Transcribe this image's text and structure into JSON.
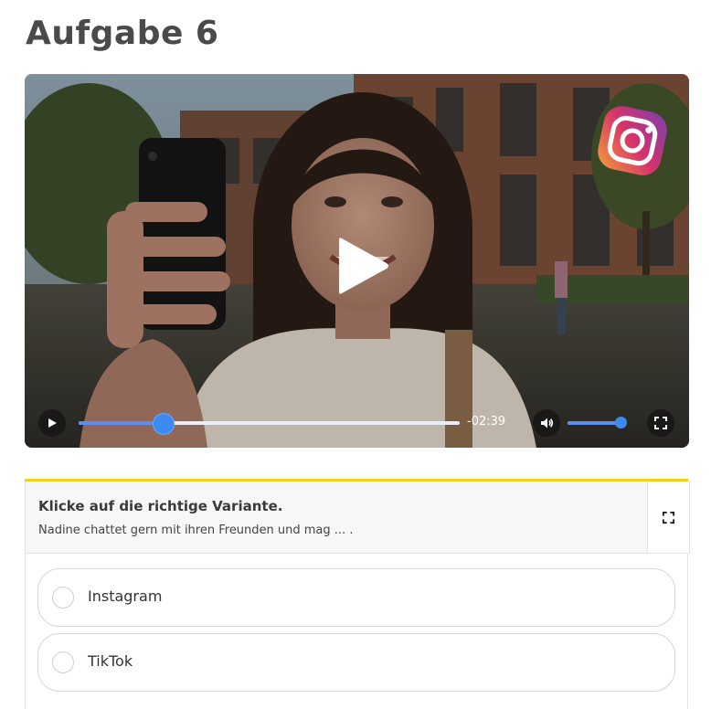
{
  "page": {
    "title": "Aufgabe 6"
  },
  "video": {
    "progress": 0.22,
    "time_remaining": "-02:39",
    "volume": 0.9,
    "icons": {
      "center_play": "play-icon",
      "play": "play-icon",
      "volume": "volume-icon",
      "fullscreen": "fullscreen-icon",
      "overlay_logo": "instagram-logo"
    }
  },
  "task": {
    "instruction": "Klicke auf die richtige Variante.",
    "sentence": "Nadine chattet gern mit ihren Freunden und mag ... .",
    "options": [
      {
        "label": "Instagram",
        "selected": false
      },
      {
        "label": "TikTok",
        "selected": false
      }
    ]
  },
  "colors": {
    "accent": "#f2cf1d",
    "control_blue": "#3d8bf2",
    "title": "#4a4a4a"
  }
}
